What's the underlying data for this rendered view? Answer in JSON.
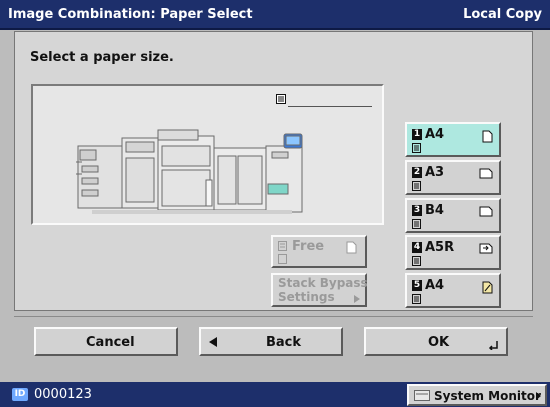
{
  "title_bar": {
    "title": "Image Combination: Paper Select",
    "mode": "Local Copy"
  },
  "instruction": "Select a paper size.",
  "paper_buttons": [
    {
      "number": "1",
      "size": "A4",
      "orientation": "portrait",
      "selected": true
    },
    {
      "number": "2",
      "size": "A3",
      "orientation": "landscape",
      "selected": false
    },
    {
      "number": "3",
      "size": "B4",
      "orientation": "landscape",
      "selected": false
    },
    {
      "number": "4",
      "size": "A5R",
      "orientation": "landscape-rotated",
      "selected": false
    },
    {
      "number": "5",
      "size": "A4",
      "orientation": "portrait-colored",
      "selected": false
    }
  ],
  "free_button": {
    "label": "Free",
    "enabled": false
  },
  "stack_bypass_button": {
    "label_line1": "Stack Bypass",
    "label_line2": "Settings",
    "enabled": false
  },
  "bottom_buttons": {
    "cancel": "Cancel",
    "back": "Back",
    "ok": "OK"
  },
  "footer": {
    "id_badge": "ID",
    "id_number": "0000123",
    "system_monitor": "System Monitor"
  },
  "colors": {
    "title_bar": "#1d2f6b",
    "selected_button": "#aee8e0",
    "panel": "#d6d6d6"
  },
  "icons": [
    "tray-icon",
    "printer-machine-illustration",
    "portrait-paper-icon",
    "landscape-paper-icon",
    "arrow-left-icon",
    "arrow-right-icon",
    "enter-icon"
  ]
}
